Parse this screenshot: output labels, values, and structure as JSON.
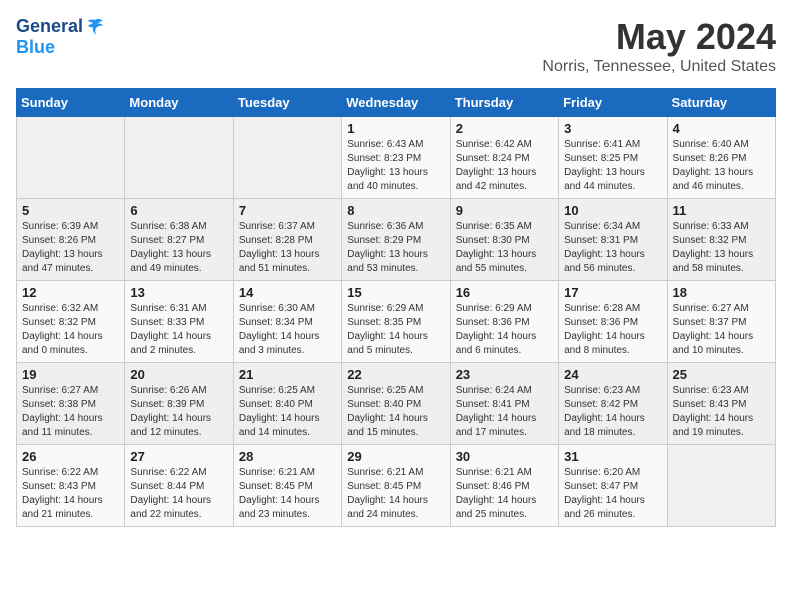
{
  "header": {
    "logo_general": "General",
    "logo_blue": "Blue",
    "main_title": "May 2024",
    "subtitle": "Norris, Tennessee, United States"
  },
  "weekdays": [
    "Sunday",
    "Monday",
    "Tuesday",
    "Wednesday",
    "Thursday",
    "Friday",
    "Saturday"
  ],
  "weeks": [
    [
      {
        "day": "",
        "info": ""
      },
      {
        "day": "",
        "info": ""
      },
      {
        "day": "",
        "info": ""
      },
      {
        "day": "1",
        "info": "Sunrise: 6:43 AM\nSunset: 8:23 PM\nDaylight: 13 hours\nand 40 minutes."
      },
      {
        "day": "2",
        "info": "Sunrise: 6:42 AM\nSunset: 8:24 PM\nDaylight: 13 hours\nand 42 minutes."
      },
      {
        "day": "3",
        "info": "Sunrise: 6:41 AM\nSunset: 8:25 PM\nDaylight: 13 hours\nand 44 minutes."
      },
      {
        "day": "4",
        "info": "Sunrise: 6:40 AM\nSunset: 8:26 PM\nDaylight: 13 hours\nand 46 minutes."
      }
    ],
    [
      {
        "day": "5",
        "info": "Sunrise: 6:39 AM\nSunset: 8:26 PM\nDaylight: 13 hours\nand 47 minutes."
      },
      {
        "day": "6",
        "info": "Sunrise: 6:38 AM\nSunset: 8:27 PM\nDaylight: 13 hours\nand 49 minutes."
      },
      {
        "day": "7",
        "info": "Sunrise: 6:37 AM\nSunset: 8:28 PM\nDaylight: 13 hours\nand 51 minutes."
      },
      {
        "day": "8",
        "info": "Sunrise: 6:36 AM\nSunset: 8:29 PM\nDaylight: 13 hours\nand 53 minutes."
      },
      {
        "day": "9",
        "info": "Sunrise: 6:35 AM\nSunset: 8:30 PM\nDaylight: 13 hours\nand 55 minutes."
      },
      {
        "day": "10",
        "info": "Sunrise: 6:34 AM\nSunset: 8:31 PM\nDaylight: 13 hours\nand 56 minutes."
      },
      {
        "day": "11",
        "info": "Sunrise: 6:33 AM\nSunset: 8:32 PM\nDaylight: 13 hours\nand 58 minutes."
      }
    ],
    [
      {
        "day": "12",
        "info": "Sunrise: 6:32 AM\nSunset: 8:32 PM\nDaylight: 14 hours\nand 0 minutes."
      },
      {
        "day": "13",
        "info": "Sunrise: 6:31 AM\nSunset: 8:33 PM\nDaylight: 14 hours\nand 2 minutes."
      },
      {
        "day": "14",
        "info": "Sunrise: 6:30 AM\nSunset: 8:34 PM\nDaylight: 14 hours\nand 3 minutes."
      },
      {
        "day": "15",
        "info": "Sunrise: 6:29 AM\nSunset: 8:35 PM\nDaylight: 14 hours\nand 5 minutes."
      },
      {
        "day": "16",
        "info": "Sunrise: 6:29 AM\nSunset: 8:36 PM\nDaylight: 14 hours\nand 6 minutes."
      },
      {
        "day": "17",
        "info": "Sunrise: 6:28 AM\nSunset: 8:36 PM\nDaylight: 14 hours\nand 8 minutes."
      },
      {
        "day": "18",
        "info": "Sunrise: 6:27 AM\nSunset: 8:37 PM\nDaylight: 14 hours\nand 10 minutes."
      }
    ],
    [
      {
        "day": "19",
        "info": "Sunrise: 6:27 AM\nSunset: 8:38 PM\nDaylight: 14 hours\nand 11 minutes."
      },
      {
        "day": "20",
        "info": "Sunrise: 6:26 AM\nSunset: 8:39 PM\nDaylight: 14 hours\nand 12 minutes."
      },
      {
        "day": "21",
        "info": "Sunrise: 6:25 AM\nSunset: 8:40 PM\nDaylight: 14 hours\nand 14 minutes."
      },
      {
        "day": "22",
        "info": "Sunrise: 6:25 AM\nSunset: 8:40 PM\nDaylight: 14 hours\nand 15 minutes."
      },
      {
        "day": "23",
        "info": "Sunrise: 6:24 AM\nSunset: 8:41 PM\nDaylight: 14 hours\nand 17 minutes."
      },
      {
        "day": "24",
        "info": "Sunrise: 6:23 AM\nSunset: 8:42 PM\nDaylight: 14 hours\nand 18 minutes."
      },
      {
        "day": "25",
        "info": "Sunrise: 6:23 AM\nSunset: 8:43 PM\nDaylight: 14 hours\nand 19 minutes."
      }
    ],
    [
      {
        "day": "26",
        "info": "Sunrise: 6:22 AM\nSunset: 8:43 PM\nDaylight: 14 hours\nand 21 minutes."
      },
      {
        "day": "27",
        "info": "Sunrise: 6:22 AM\nSunset: 8:44 PM\nDaylight: 14 hours\nand 22 minutes."
      },
      {
        "day": "28",
        "info": "Sunrise: 6:21 AM\nSunset: 8:45 PM\nDaylight: 14 hours\nand 23 minutes."
      },
      {
        "day": "29",
        "info": "Sunrise: 6:21 AM\nSunset: 8:45 PM\nDaylight: 14 hours\nand 24 minutes."
      },
      {
        "day": "30",
        "info": "Sunrise: 6:21 AM\nSunset: 8:46 PM\nDaylight: 14 hours\nand 25 minutes."
      },
      {
        "day": "31",
        "info": "Sunrise: 6:20 AM\nSunset: 8:47 PM\nDaylight: 14 hours\nand 26 minutes."
      },
      {
        "day": "",
        "info": ""
      }
    ]
  ]
}
